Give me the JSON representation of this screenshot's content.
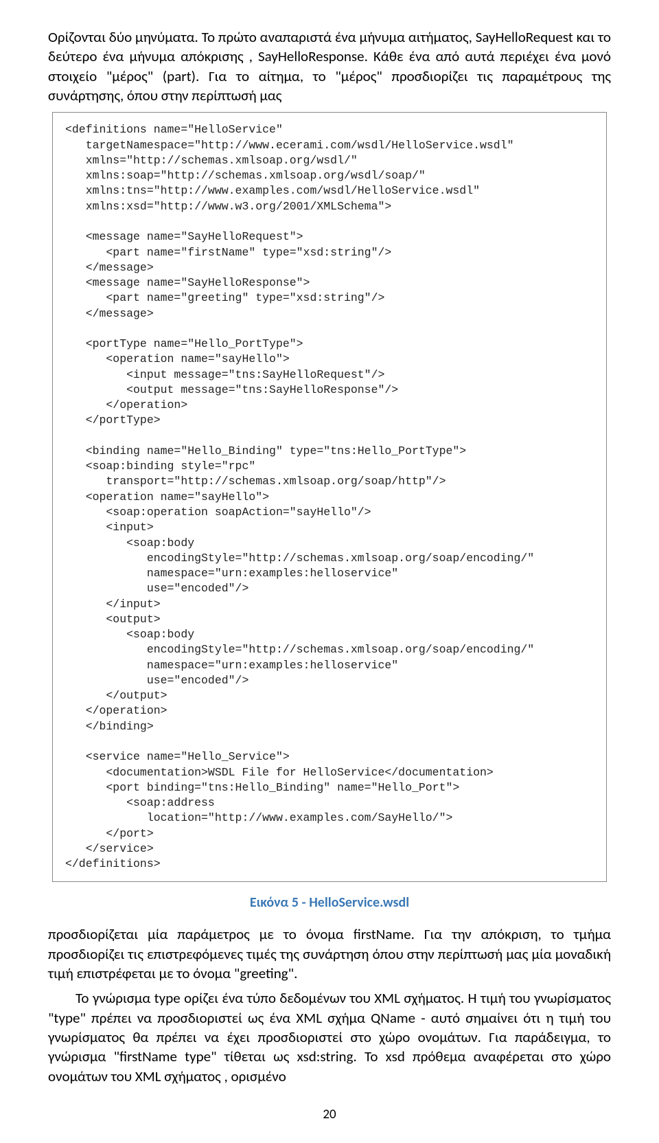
{
  "para1": "Ορίζονται δύο μηνύματα. Το πρώτο αναπαριστά ένα μήνυμα αιτήματος, SayHelloRequest και το δεύτερο ένα μήνυμα απόκρισης , SayHelloResponse. Κάθε ένα από αυτά περιέχει ένα μονό  στοιχείο \"μέρος\" (part). Για το αίτημα, το \"μέρος\" προσδιορίζει τις παραμέτρους της συνάρτησης, όπου στην περίπτωσή μας",
  "code": "<definitions name=\"HelloService\"\n   targetNamespace=\"http://www.ecerami.com/wsdl/HelloService.wsdl\"\n   xmlns=\"http://schemas.xmlsoap.org/wsdl/\"\n   xmlns:soap=\"http://schemas.xmlsoap.org/wsdl/soap/\"\n   xmlns:tns=\"http://www.examples.com/wsdl/HelloService.wsdl\"\n   xmlns:xsd=\"http://www.w3.org/2001/XMLSchema\">\n\n   <message name=\"SayHelloRequest\">\n      <part name=\"firstName\" type=\"xsd:string\"/>\n   </message>\n   <message name=\"SayHelloResponse\">\n      <part name=\"greeting\" type=\"xsd:string\"/>\n   </message>\n\n   <portType name=\"Hello_PortType\">\n      <operation name=\"sayHello\">\n         <input message=\"tns:SayHelloRequest\"/>\n         <output message=\"tns:SayHelloResponse\"/>\n      </operation>\n   </portType>\n\n   <binding name=\"Hello_Binding\" type=\"tns:Hello_PortType\">\n   <soap:binding style=\"rpc\"\n      transport=\"http://schemas.xmlsoap.org/soap/http\"/>\n   <operation name=\"sayHello\">\n      <soap:operation soapAction=\"sayHello\"/>\n      <input>\n         <soap:body\n            encodingStyle=\"http://schemas.xmlsoap.org/soap/encoding/\"\n            namespace=\"urn:examples:helloservice\"\n            use=\"encoded\"/>\n      </input>\n      <output>\n         <soap:body\n            encodingStyle=\"http://schemas.xmlsoap.org/soap/encoding/\"\n            namespace=\"urn:examples:helloservice\"\n            use=\"encoded\"/>\n      </output>\n   </operation>\n   </binding>\n\n   <service name=\"Hello_Service\">\n      <documentation>WSDL File for HelloService</documentation>\n      <port binding=\"tns:Hello_Binding\" name=\"Hello_Port\">\n         <soap:address\n            location=\"http://www.examples.com/SayHello/\">\n      </port>\n   </service>\n</definitions>",
  "figure_caption": "Εικόνα 5 - HelloService.wsdl",
  "para2": "προσδιορίζεται μία παράμετρος με το όνομα firstName. Για την απόκριση, το τμήμα προσδιορίζει τις επιστρεφόμενες τιμές της συνάρτηση όπου στην περίπτωσή μας μία μοναδική τιμή επιστρέφεται με το όνομα \"greeting\".",
  "para3": "Το γνώρισμα type ορίζει ένα τύπο δεδομένων του XML σχήματος. Η τιμή του γνωρίσματος \"type\" πρέπει να προσδιοριστεί ως ένα XML σχήμα QName - αυτό σημαίνει ότι η τιμή του γνωρίσματος θα πρέπει να έχει προσδιοριστεί στο χώρο ονομάτων. Για παράδειγμα, το γνώρισμα \"firstName type\" τίθεται ως xsd:string. Το xsd πρόθεμα αναφέρεται στο χώρο ονομάτων του XML σχήματος , ορισμένο",
  "page_number": "20"
}
